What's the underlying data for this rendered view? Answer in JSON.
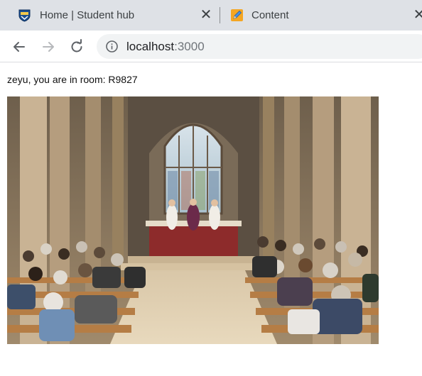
{
  "tabs": [
    {
      "title": "Home | Student hub",
      "active": false,
      "favicon": "university-crest-icon"
    },
    {
      "title": "Content",
      "active": true,
      "favicon": "pencil-note-icon"
    }
  ],
  "toolbar": {
    "url_host": "localhost",
    "url_port": ":3000"
  },
  "page": {
    "room_message": "zeyu, you are in room: R9827",
    "image": "church-congregation-photo"
  }
}
